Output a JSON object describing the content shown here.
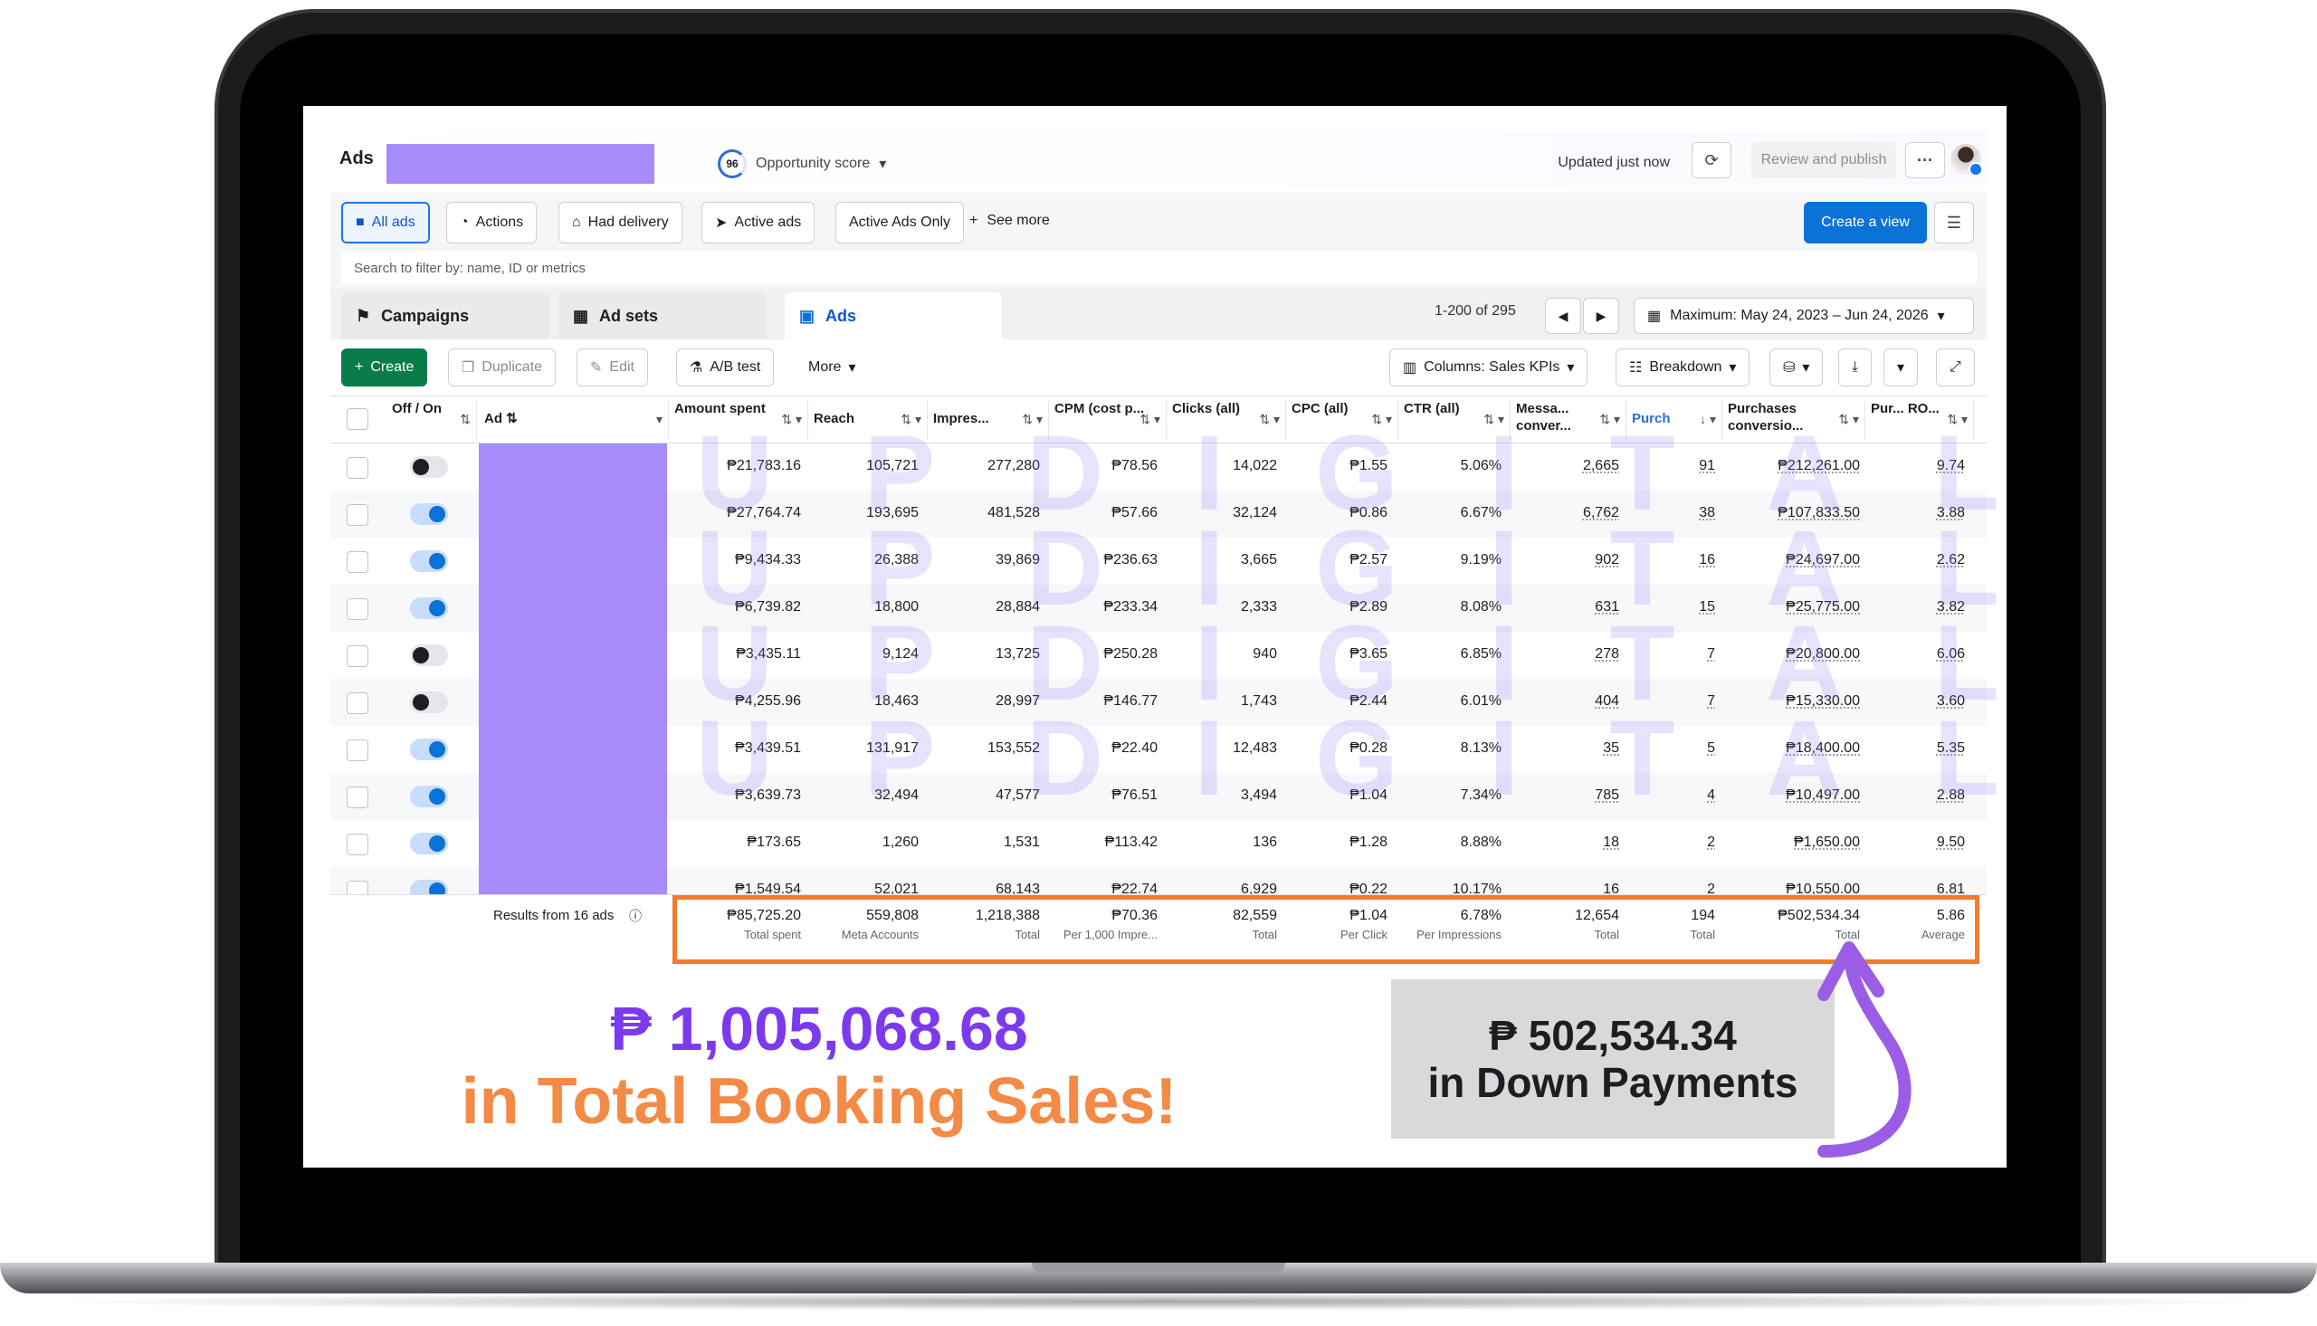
{
  "header": {
    "title": "Ads",
    "opportunity_score": "96",
    "opportunity_label": "Opportunity score",
    "updated": "Updated just now",
    "review_publish": "Review and publish",
    "more_dots": "···"
  },
  "filters": {
    "all_ads": "All ads",
    "actions": "Actions",
    "had_delivery": "Had delivery",
    "active_ads": "Active ads",
    "active_ads_only": "Active Ads Only",
    "see_more": "See more",
    "create_view": "Create a view",
    "search_placeholder": "Search to filter by: name, ID or metrics"
  },
  "tabs": {
    "campaigns": "Campaigns",
    "ad_sets": "Ad sets",
    "ads": "Ads",
    "pagination": "1-200 of 295",
    "date_range": "Maximum: May 24, 2023 – Jun 24, 2026"
  },
  "toolbar": {
    "create": "Create",
    "duplicate": "Duplicate",
    "edit": "Edit",
    "ab_test": "A/B test",
    "more": "More",
    "columns": "Columns: Sales KPIs",
    "breakdown": "Breakdown"
  },
  "table": {
    "headers": {
      "offon": "Off / On",
      "ad": "Ad",
      "amount": "Amount spent",
      "reach": "Reach",
      "impressions": "Impres...",
      "cpm": "CPM (cost p...",
      "clicks": "Clicks (all)",
      "cpc": "CPC (all)",
      "ctr": "CTR (all)",
      "messaging": "Messa... conver...",
      "purch": "Purch",
      "purch_conv": "Purchases conversio...",
      "roas": "Pur... RO..."
    },
    "rows": [
      {
        "on": false,
        "amount": "₱21,783.16",
        "reach": "105,721",
        "impressions": "277,280",
        "cpm": "₱78.56",
        "clicks": "14,022",
        "cpc": "₱1.55",
        "ctr": "5.06%",
        "messaging": "2,665",
        "purch": "91",
        "purch_conv": "₱212,261.00",
        "roas": "9.74"
      },
      {
        "on": true,
        "amount": "₱27,764.74",
        "reach": "193,695",
        "impressions": "481,528",
        "cpm": "₱57.66",
        "clicks": "32,124",
        "cpc": "₱0.86",
        "ctr": "6.67%",
        "messaging": "6,762",
        "purch": "38",
        "purch_conv": "₱107,833.50",
        "roas": "3.88"
      },
      {
        "on": true,
        "amount": "₱9,434.33",
        "reach": "26,388",
        "impressions": "39,869",
        "cpm": "₱236.63",
        "clicks": "3,665",
        "cpc": "₱2.57",
        "ctr": "9.19%",
        "messaging": "902",
        "purch": "16",
        "purch_conv": "₱24,697.00",
        "roas": "2.62"
      },
      {
        "on": true,
        "amount": "₱6,739.82",
        "reach": "18,800",
        "impressions": "28,884",
        "cpm": "₱233.34",
        "clicks": "2,333",
        "cpc": "₱2.89",
        "ctr": "8.08%",
        "messaging": "631",
        "purch": "15",
        "purch_conv": "₱25,775.00",
        "roas": "3.82"
      },
      {
        "on": false,
        "amount": "₱3,435.11",
        "reach": "9,124",
        "impressions": "13,725",
        "cpm": "₱250.28",
        "clicks": "940",
        "cpc": "₱3.65",
        "ctr": "6.85%",
        "messaging": "278",
        "purch": "7",
        "purch_conv": "₱20,800.00",
        "roas": "6.06"
      },
      {
        "on": false,
        "amount": "₱4,255.96",
        "reach": "18,463",
        "impressions": "28,997",
        "cpm": "₱146.77",
        "clicks": "1,743",
        "cpc": "₱2.44",
        "ctr": "6.01%",
        "messaging": "404",
        "purch": "7",
        "purch_conv": "₱15,330.00",
        "roas": "3.60"
      },
      {
        "on": true,
        "amount": "₱3,439.51",
        "reach": "131,917",
        "impressions": "153,552",
        "cpm": "₱22.40",
        "clicks": "12,483",
        "cpc": "₱0.28",
        "ctr": "8.13%",
        "messaging": "35",
        "purch": "5",
        "purch_conv": "₱18,400.00",
        "roas": "5.35"
      },
      {
        "on": true,
        "amount": "₱3,639.73",
        "reach": "32,494",
        "impressions": "47,577",
        "cpm": "₱76.51",
        "clicks": "3,494",
        "cpc": "₱1.04",
        "ctr": "7.34%",
        "messaging": "785",
        "purch": "4",
        "purch_conv": "₱10,497.00",
        "roas": "2.88"
      },
      {
        "on": true,
        "amount": "₱173.65",
        "reach": "1,260",
        "impressions": "1,531",
        "cpm": "₱113.42",
        "clicks": "136",
        "cpc": "₱1.28",
        "ctr": "8.88%",
        "messaging": "18",
        "purch": "2",
        "purch_conv": "₱1,650.00",
        "roas": "9.50"
      },
      {
        "on": true,
        "amount": "₱1,549.54",
        "reach": "52,021",
        "impressions": "68,143",
        "cpm": "₱22.74",
        "clicks": "6,929",
        "cpc": "₱0.22",
        "ctr": "10.17%",
        "messaging": "16",
        "purch": "2",
        "purch_conv": "₱10,550.00",
        "roas": "6.81"
      }
    ],
    "footer": {
      "results_label": "Results from 16 ads",
      "amount": "₱85,725.20",
      "amount_sub": "Total spent",
      "reach": "559,808",
      "reach_sub": "Meta Accounts",
      "impressions": "1,218,388",
      "impressions_sub": "Total",
      "cpm": "₱70.36",
      "cpm_sub": "Per 1,000 Impre...",
      "clicks": "82,559",
      "clicks_sub": "Total",
      "cpc": "₱1.04",
      "cpc_sub": "Per Click",
      "ctr": "6.78%",
      "ctr_sub": "Per Impressions",
      "messaging": "12,654",
      "messaging_sub": "Total",
      "purch": "194",
      "purch_sub": "Total",
      "purch_conv": "₱502,534.34",
      "purch_conv_sub": "Total",
      "roas": "5.86",
      "roas_sub": "Average"
    }
  },
  "watermark": [
    "U",
    "P",
    "D",
    "I",
    "G",
    "I",
    "T",
    "A",
    "L"
  ],
  "promo": {
    "total": "₱ 1,005,068.68",
    "total_label": "in Total Booking Sales!",
    "down_amount": "₱ 502,534.34",
    "down_label": "in Down Payments"
  },
  "colors": {
    "accent": "#0b72d6",
    "redaction": "#a78bfa",
    "highlight": "#f47b2a",
    "promo_purple": "#7c3aed",
    "promo_orange": "#f38a45",
    "arrow": "#9b5de5"
  }
}
